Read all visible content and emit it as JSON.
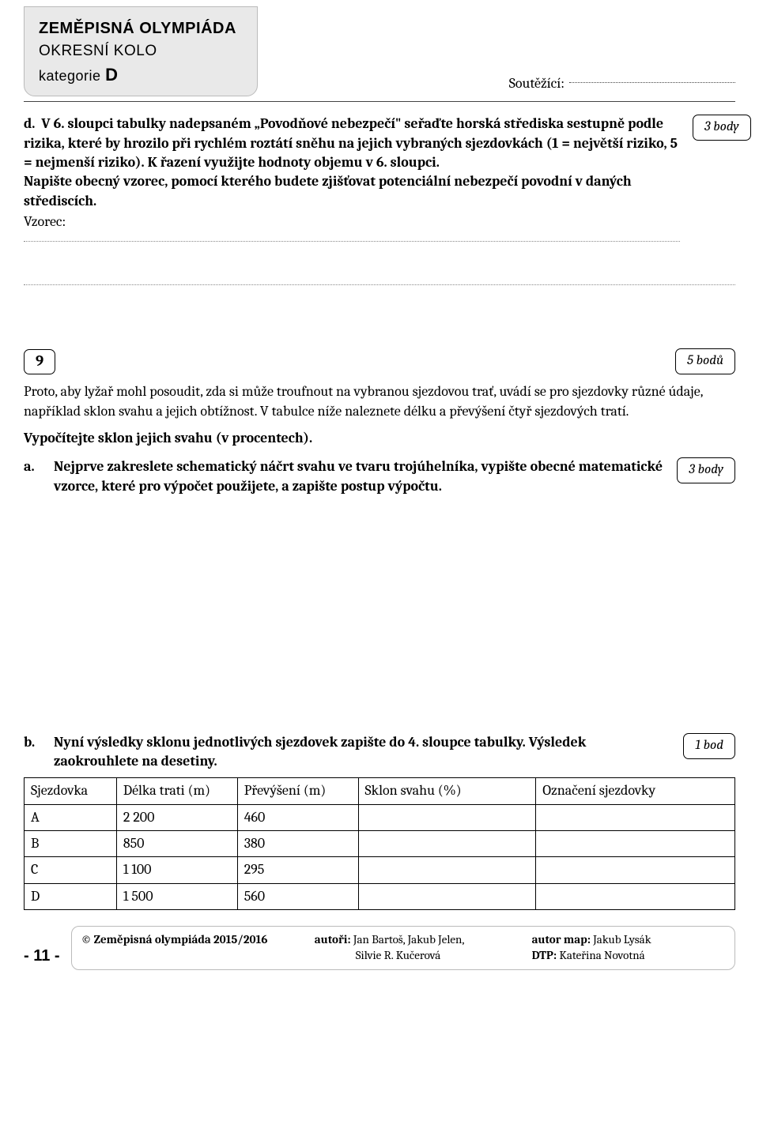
{
  "header_box": {
    "line1": "ZEMĚPISNÁ OLYMPIÁDA",
    "line2": "OKRESNÍ KOLO",
    "line3a": "kategorie ",
    "line3b": "D"
  },
  "competitor_label": "Soutěžící:",
  "task_d": {
    "prefix": "d.",
    "text_bold_part": "V 6. sloupci tabulky nadepsaném „Povodňové nebezpečí\" seřaďte horská střediska sestupně podle rizika, které by hrozilo při rychlém roztátí sněhu na jejich vybraných sjezdovkách (1 = největší riziko, 5 = nejmenší riziko). K řazení využijte hodnoty objemu v 6. sloupci.",
    "text2": "Napište obecný vzorec, pomocí kterého budete zjišťovat potenciální nebezpečí povodní v daných střediscích.",
    "vz": "Vzorec:",
    "points": "3 body"
  },
  "q9": {
    "num": "9",
    "points": "5 bodů",
    "intro": "Proto, aby lyžař mohl posoudit, zda si může troufnout na vybranou sjezdovou trať, uvádí se pro sjezdovky různé údaje, například sklon svahu a jejich obtížnost. V tabulce níže naleznete délku a převýšení čtyř sjezdových tratí.",
    "intro2": "Vypočítejte sklon jejich svahu (v procentech).",
    "a": {
      "prefix": "a.",
      "text": "Nejprve zakreslete schematický náčrt svahu ve tvaru trojúhelníka, vypište obecné matematické vzorce, které pro výpočet použijete, a zapište postup výpočtu.",
      "points": "3 body"
    },
    "b": {
      "prefix": "b.",
      "text": "Nyní výsledky sklonu jednotlivých sjezdovek zapište do 4. sloupce tabulky. Výsledek zaokrouhlete na desetiny.",
      "points": "1 bod"
    }
  },
  "table": {
    "headers": [
      "Sjezdovka",
      "Délka trati (m)",
      "Převýšení (m)",
      "Sklon svahu (%)",
      "Označení sjezdovky"
    ],
    "rows": [
      {
        "a": "A",
        "b": "2 200",
        "c": "460"
      },
      {
        "a": "B",
        "b": "850",
        "c": "380"
      },
      {
        "a": "C",
        "b": "1 100",
        "c": "295"
      },
      {
        "a": "D",
        "b": "1 500",
        "c": "560"
      }
    ]
  },
  "footer": {
    "page": "- 11 -",
    "copy": "© Zeměpisná olympiáda 2015/2016",
    "authors_label": "autoři: ",
    "authors": "Jan Bartoš, Jakub Jelen,",
    "authors2": "Silvie R. Kučerová",
    "map_label": "autor map: ",
    "map": "Jakub Lysák",
    "dtp_label": "DTP: ",
    "dtp": "Kateřina Novotná"
  }
}
